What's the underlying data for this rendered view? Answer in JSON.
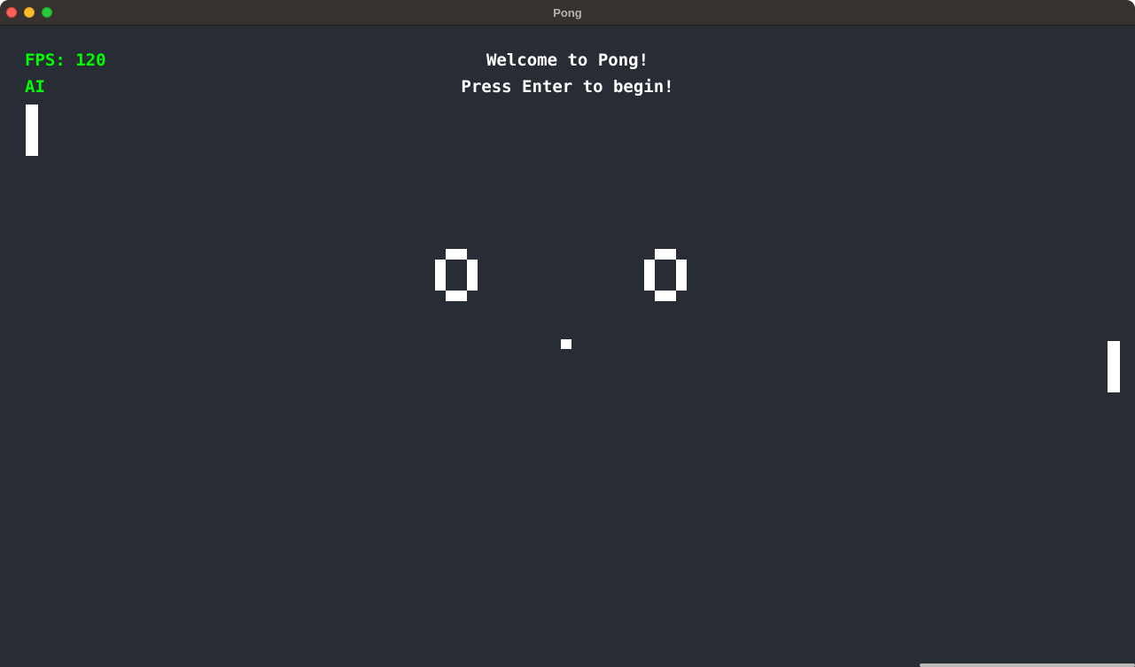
{
  "window": {
    "title": "Pong"
  },
  "hud": {
    "fps_label": "FPS: 120",
    "mode_label": "AI"
  },
  "message": {
    "welcome": "Welcome to Pong!",
    "prompt": "Press Enter to begin!"
  },
  "scores": {
    "left": "0",
    "right": "0"
  },
  "colors": {
    "background": "#282c34",
    "hud_text": "#00ff00",
    "foreground": "#ffffff",
    "titlebar": "#37322f"
  }
}
